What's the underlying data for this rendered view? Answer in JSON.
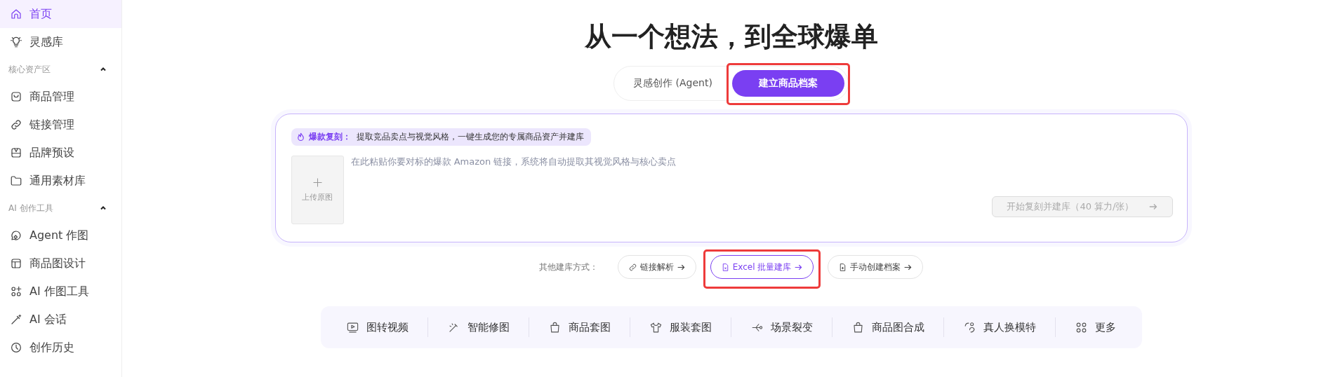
{
  "sidebar": {
    "items": [
      {
        "kind": "item",
        "label": "首页",
        "selected": true
      },
      {
        "kind": "item",
        "label": "灵感库",
        "selected": false
      },
      {
        "kind": "section",
        "label": "核心资产区",
        "expanded": true
      },
      {
        "kind": "item",
        "label": "商品管理",
        "selected": false
      },
      {
        "kind": "item",
        "label": "链接管理",
        "selected": false
      },
      {
        "kind": "item",
        "label": "品牌预设",
        "selected": false
      },
      {
        "kind": "item",
        "label": "通用素材库",
        "selected": false
      },
      {
        "kind": "section",
        "label": "AI 创作工具",
        "expanded": true
      },
      {
        "kind": "item",
        "label": "Agent 作图",
        "selected": false
      },
      {
        "kind": "item",
        "label": "商品图设计",
        "selected": false
      },
      {
        "kind": "item",
        "label": "AI 作图工具",
        "selected": false
      },
      {
        "kind": "item",
        "label": "AI 会话",
        "selected": false
      },
      {
        "kind": "item",
        "label": "创作历史",
        "selected": false
      }
    ]
  },
  "headline": "从一个想法，到全球爆单",
  "tabs": [
    {
      "label": "灵感创作 (Agent)",
      "selected": false,
      "highlighted": false
    },
    {
      "label": "建立商品档案",
      "selected": true,
      "highlighted": true
    }
  ],
  "card": {
    "tag": {
      "label": "爆款复刻：",
      "text": "提取竞品卖点与视觉风格，一键生成您的专属商品资产并建库"
    },
    "upload": {
      "label": "上传原图"
    },
    "link_field": {
      "placeholder": "在此粘贴你要对标的爆款 Amazon 链接，系统将自动提取其视觉风格与核心卖点"
    },
    "submit": {
      "label": "开始复刻并建库（40 算力/张）",
      "disabled": true
    }
  },
  "other_methods": {
    "label": "其他建库方式：",
    "buttons": [
      {
        "label": "链接解析",
        "selected": false,
        "highlighted": false
      },
      {
        "label": "Excel 批量建库",
        "selected": true,
        "highlighted": true
      },
      {
        "label": "手动创建档案",
        "selected": false,
        "highlighted": false
      }
    ]
  },
  "toolbar": [
    "图转视频",
    "智能修图",
    "商品套图",
    "服装套图",
    "场景裂变",
    "商品图合成",
    "真人换模特",
    "更多"
  ]
}
